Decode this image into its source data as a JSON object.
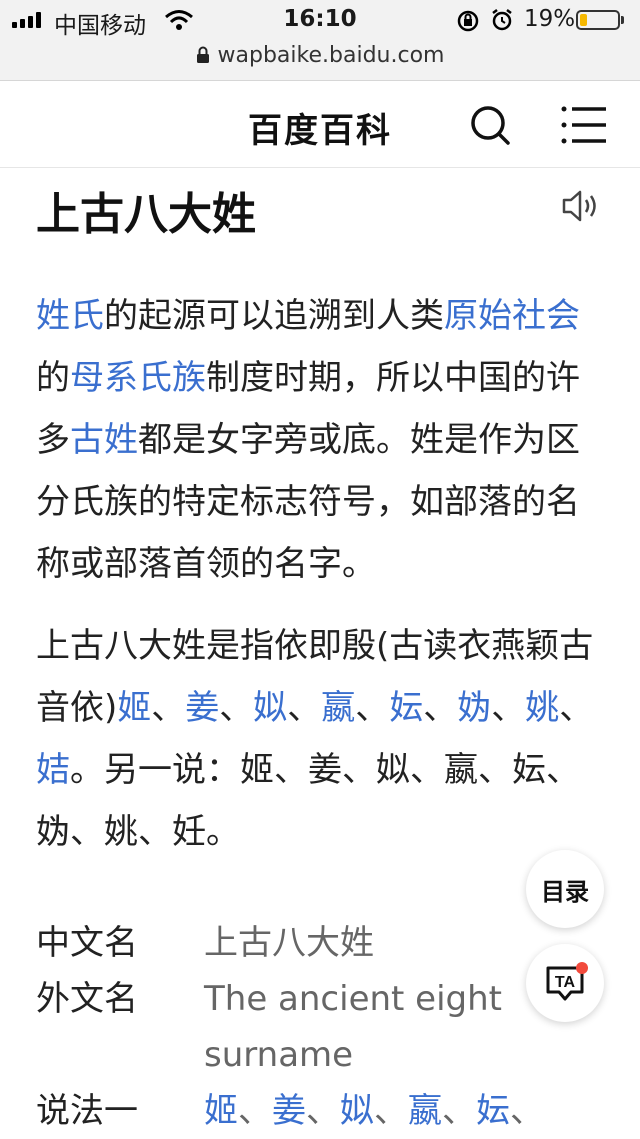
{
  "status": {
    "carrier": "中国移动",
    "time": "16:10",
    "battery_percent": "19%",
    "battery_level": 0.19,
    "battery_color": "#f5b800"
  },
  "url_bar": {
    "domain": "wapbaike.baidu.com",
    "icon": "lock-icon"
  },
  "header": {
    "title": "百度百科",
    "search_icon": "search-icon",
    "menu_icon": "menu-icon"
  },
  "article": {
    "title": "上古八大姓",
    "speaker_icon": "speaker-icon",
    "para1": {
      "link_xingshi": "姓氏",
      "t1": "的起源可以追溯到人类",
      "link_yuanshi": "原始社会",
      "t2": "的",
      "link_muxi": "母系氏族",
      "t3": "制度时期，所以中国的许多",
      "link_guxing": "古姓",
      "t4": "都是女字旁或底。姓是作为区分氏族的特定标志符号，如部落的名称或部落首领的名字。"
    },
    "para2": {
      "t1": "上古八大姓是指依即殷(古读衣燕颖古音依)",
      "links": [
        "姬",
        "姜",
        "姒",
        "嬴",
        "妘",
        "妫",
        "姚",
        "姞"
      ],
      "t2": "。另一说：姬、姜、姒、嬴、妘、妫、姚、妊。"
    },
    "link_color": "#3a6fcf"
  },
  "info_table": {
    "rows": [
      {
        "label": "中文名",
        "value": "上古八大姓"
      },
      {
        "label": "外文名",
        "value": "The ancient eight surname"
      },
      {
        "label": "说法一",
        "links": [
          "姬",
          "姜",
          "姒",
          "嬴",
          "妘"
        ]
      }
    ]
  },
  "floating": {
    "toc_label": "目录",
    "ta_label": "TA",
    "ta_icon": "ta-speech-icon"
  }
}
